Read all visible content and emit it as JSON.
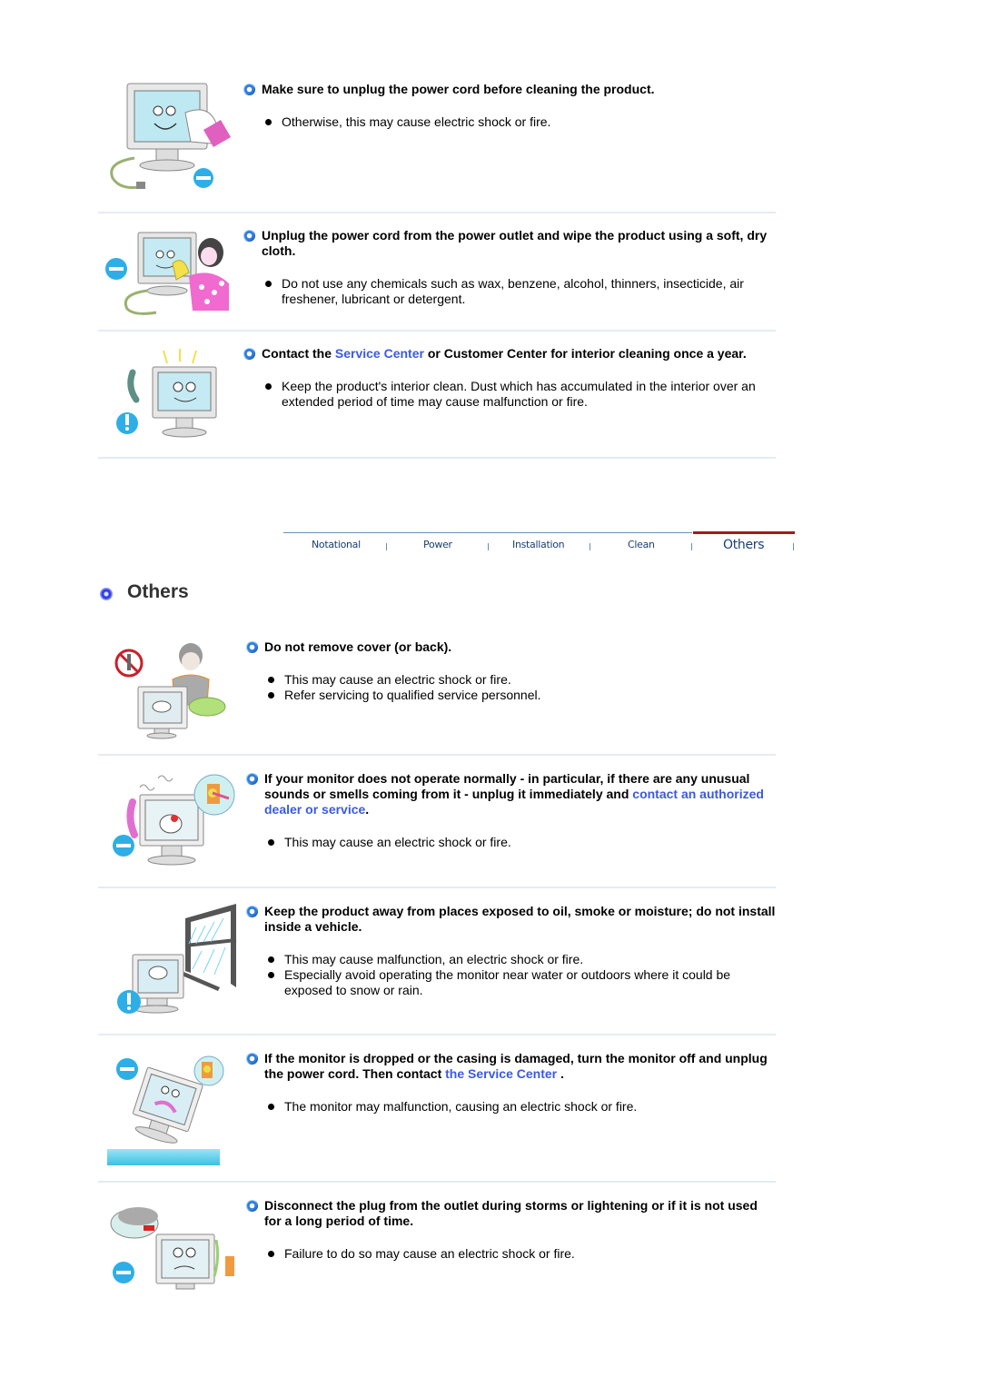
{
  "clean_items": [
    {
      "heading": "Make sure to unplug the power cord before cleaning the product.",
      "points": [
        "Otherwise, this may cause electric shock or fire."
      ],
      "illustration": "monitor-cleaning-unplug"
    },
    {
      "heading": "Unplug the power cord from the power outlet and wipe the product using a soft, dry cloth.",
      "points": [
        "Do not use any chemicals such as wax, benzene, alcohol, thinners, insecticide, air freshener, lubricant or detergent."
      ],
      "illustration": "woman-wiping-monitor"
    },
    {
      "heading_before": "Contact the ",
      "heading_link": "Service Center",
      "heading_after": " or Customer Center for interior cleaning once a year.",
      "points": [
        "Keep the product's interior clean. Dust which has accumulated in the interior over an extended period of time may cause malfunction or fire."
      ],
      "illustration": "monitor-phone-call"
    }
  ],
  "nav": {
    "tabs": [
      "Notational",
      "Power",
      "Installation",
      "Clean",
      "Others"
    ],
    "active": "Others"
  },
  "section_title": "Others",
  "others_items": [
    {
      "heading": "Do not remove cover (or back).",
      "points": [
        "This may cause an electric shock or fire.",
        "Refer servicing to qualified service personnel."
      ],
      "illustration": "technician-opening-monitor"
    },
    {
      "heading_before": "If your monitor does not operate normally - in particular, if there are any unusual sounds or smells coming from it - unplug it immediately and ",
      "heading_link": "contact an authorized dealer or service",
      "heading_after": ".",
      "points": [
        "This may cause an electric shock or fire."
      ],
      "illustration": "smoking-monitor-phone"
    },
    {
      "heading": "Keep the product away from places exposed to oil, smoke or moisture; do not install inside a vehicle.",
      "points": [
        "This may cause malfunction, an electric shock or fire.",
        "Especially avoid operating the monitor near water or outdoors where it could be exposed to snow or rain."
      ],
      "illustration": "monitor-near-rainy-window"
    },
    {
      "heading_before": "If the monitor is dropped or the casing is damaged, turn the monitor off and unplug the power cord. Then contact ",
      "heading_link": "the Service Center",
      "heading_after": " .",
      "points": [
        "The monitor may malfunction, causing an electric shock or fire."
      ],
      "illustration": "dropped-monitor"
    },
    {
      "heading": "Disconnect the plug from the outlet during storms or lightening or if it is not used for a long period of time.",
      "points": [
        "Failure to do so may cause an electric shock or fire."
      ],
      "illustration": "monitor-storm-unplug"
    }
  ],
  "colors": {
    "link": "#3b5ae0",
    "divider": "#e4ecf0",
    "nav_text": "#1a3f74",
    "nav_active_bar": "#a01c1c"
  }
}
